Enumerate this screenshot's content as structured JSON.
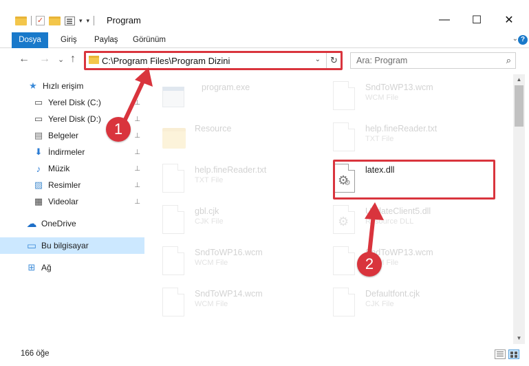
{
  "window": {
    "title": "Program",
    "minimize_glyph": "—",
    "maximize_glyph": "☐",
    "close_glyph": "✕"
  },
  "ribbon": {
    "tabs": [
      {
        "label": "Dosya"
      },
      {
        "label": "Giriş"
      },
      {
        "label": "Paylaş"
      },
      {
        "label": "Görünüm"
      }
    ],
    "expand_glyph": "⌄",
    "help_glyph": "?"
  },
  "nav": {
    "back_glyph": "←",
    "forward_glyph": "→",
    "recent_glyph": "⌄",
    "up_glyph": "↑",
    "address_path": "C:\\Program Files\\Program Dizini",
    "address_drop_glyph": "⌄",
    "refresh_glyph": "↻",
    "search_placeholder": "Ara: Program",
    "search_glyph": "⌕"
  },
  "sidebar": {
    "items": [
      {
        "label": "Hızlı erişim",
        "icon": "star-icon",
        "glyph": "★",
        "color": "#3a8ad8"
      },
      {
        "label": "Yerel Disk (C:)",
        "icon": "drive-icon",
        "glyph": "▭",
        "color": "#4a4a4a",
        "pin": "📌"
      },
      {
        "label": "Yerel Disk (D:)",
        "icon": "drive-icon",
        "glyph": "▭",
        "color": "#4a4a4a",
        "pin": "📌"
      },
      {
        "label": "Belgeler",
        "icon": "documents-icon",
        "glyph": "▤",
        "color": "#6d6d6d",
        "pin": "📌"
      },
      {
        "label": "İndirmeler",
        "icon": "download-icon",
        "glyph": "⬇",
        "color": "#2a7bd3",
        "pin": "📌"
      },
      {
        "label": "Müzik",
        "icon": "music-icon",
        "glyph": "♪",
        "color": "#2a7bd3",
        "pin": "📌"
      },
      {
        "label": "Resimler",
        "icon": "pictures-icon",
        "glyph": "▨",
        "color": "#4a90d0",
        "pin": "📌"
      },
      {
        "label": "Videolar",
        "icon": "videos-icon",
        "glyph": "▦",
        "color": "#4a4a4a",
        "pin": "📌"
      },
      {
        "label": "OneDrive",
        "icon": "cloud-icon",
        "glyph": "☁",
        "color": "#1e6fc8"
      },
      {
        "label": "Bu bilgisayar",
        "icon": "computer-icon",
        "glyph": "▭",
        "color": "#3a8ad8"
      },
      {
        "label": "Ağ",
        "icon": "network-icon",
        "glyph": "⊞",
        "color": "#3a8ad8"
      }
    ]
  },
  "files": [
    {
      "name": "program.exe",
      "type": "",
      "kind": "exe",
      "faded": true
    },
    {
      "name": "SndToWP13.wcm",
      "type": "WCM File",
      "kind": "doc",
      "faded": true
    },
    {
      "name": "Resource",
      "type": "",
      "kind": "folder",
      "faded": true
    },
    {
      "name": "help.fineReader.txt",
      "type": "TXT File",
      "kind": "doc",
      "faded": true
    },
    {
      "name": "help.fineReader.txt",
      "type": "TXT File",
      "kind": "doc",
      "faded": true
    },
    {
      "name": "latex.dll",
      "type": "",
      "kind": "dll",
      "faded": false
    },
    {
      "name": "gbl.cjk",
      "type": "CJK File",
      "kind": "doc",
      "faded": true
    },
    {
      "name": "UpdateClient5.dll",
      "type": "Resource DLL",
      "kind": "dll",
      "faded": true
    },
    {
      "name": "SndToWP16.wcm",
      "type": "WCM File",
      "kind": "doc",
      "faded": true
    },
    {
      "name": "SndToWP13.wcm",
      "type": "WCM File",
      "kind": "doc",
      "faded": true
    },
    {
      "name": "SndToWP14.wcm",
      "type": "WCM File",
      "kind": "doc",
      "faded": true
    },
    {
      "name": "Defaultfont.cjk",
      "type": "CJK File",
      "kind": "doc",
      "faded": true
    }
  ],
  "status": {
    "count": "166 öğe"
  },
  "annotations": {
    "step1": "1",
    "step2": "2",
    "color": "#d9343d"
  }
}
